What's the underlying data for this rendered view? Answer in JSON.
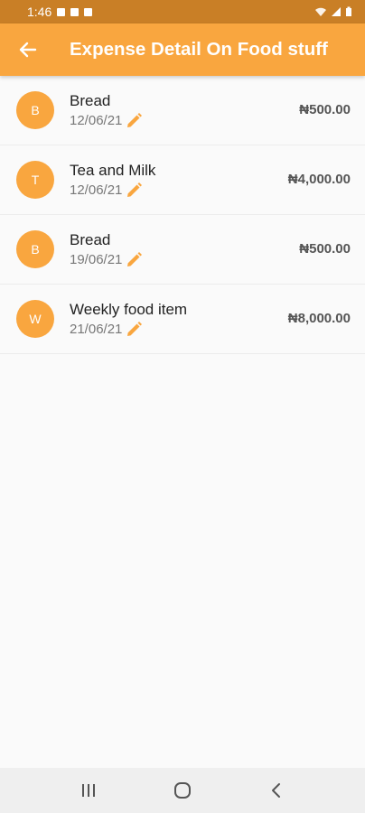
{
  "status_bar": {
    "time": "1:46"
  },
  "app_bar": {
    "title": "Expense Detail On Food stuff"
  },
  "expenses": [
    {
      "initial": "B",
      "title": "Bread",
      "date": "12/06/21",
      "amount": "₦500.00"
    },
    {
      "initial": "T",
      "title": "Tea and Milk",
      "date": "12/06/21",
      "amount": "₦4,000.00"
    },
    {
      "initial": "B",
      "title": "Bread",
      "date": "19/06/21",
      "amount": "₦500.00"
    },
    {
      "initial": "W",
      "title": "Weekly food item",
      "date": "21/06/21",
      "amount": "₦8,000.00"
    }
  ],
  "icons": {
    "back": "arrow-left-icon",
    "edit": "pencil-icon",
    "nav_recents": "recents-icon",
    "nav_home": "home-icon",
    "nav_back": "chevron-left-icon"
  },
  "colors": {
    "accent": "#f9a63f",
    "status_bar": "#c97f26",
    "background": "#fafafa"
  }
}
